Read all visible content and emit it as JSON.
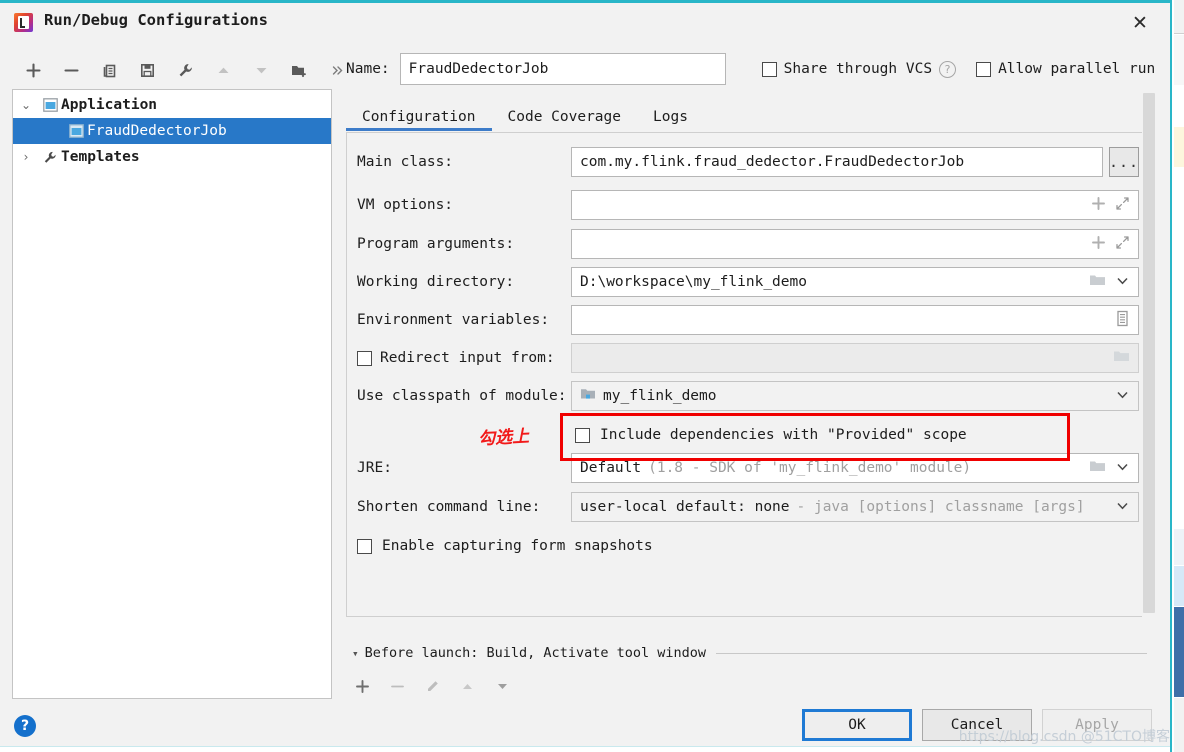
{
  "window": {
    "title": "Run/Debug Configurations",
    "app_icon": "intellij-idea-icon",
    "close_icon": "close-icon"
  },
  "toolbar": {
    "items": [
      {
        "name": "add-configuration-button",
        "icon": "plus-icon"
      },
      {
        "name": "remove-configuration-button",
        "icon": "minus-icon"
      },
      {
        "name": "copy-configuration-button",
        "icon": "copy-icon"
      },
      {
        "name": "save-configuration-button",
        "icon": "save-icon"
      },
      {
        "name": "edit-templates-button",
        "icon": "wrench-icon"
      },
      {
        "name": "move-up-button",
        "icon": "arrow-up-icon"
      },
      {
        "name": "move-down-button",
        "icon": "arrow-down-icon"
      },
      {
        "name": "new-folder-button",
        "icon": "folder-add-icon"
      },
      {
        "name": "more-options-button",
        "icon": "chevron-double-right-icon"
      }
    ]
  },
  "tree": {
    "nodes": [
      {
        "label": "Application",
        "icon": "application-icon",
        "twisty": "⌄",
        "expanded": true,
        "selected": false,
        "child": false
      },
      {
        "label": "FraudDedectorJob",
        "icon": "run-config-icon",
        "twisty": "",
        "expanded": false,
        "selected": true,
        "child": true
      },
      {
        "label": "Templates",
        "icon": "wrench-icon",
        "twisty": "›",
        "expanded": false,
        "selected": false,
        "child": false
      }
    ]
  },
  "header": {
    "name_label": "Name:",
    "name_value": "FraudDedectorJob",
    "share_vcs_label": "Share through VCS",
    "share_vcs_checked": false,
    "help_icon": "question-mark-icon",
    "allow_parallel_label": "Allow parallel run",
    "allow_parallel_checked": false
  },
  "tabs": [
    {
      "label": "Configuration",
      "active": true
    },
    {
      "label": "Code Coverage",
      "active": false
    },
    {
      "label": "Logs",
      "active": false
    }
  ],
  "form": {
    "main_class": {
      "label": "Main class:",
      "value": "com.my.flink.fraud_dedector.FraudDedectorJob",
      "browse_label": "..."
    },
    "vm_options": {
      "label": "VM options:",
      "value": "",
      "icons": [
        "plus-icon",
        "expand-icon"
      ]
    },
    "program_arguments": {
      "label": "Program arguments:",
      "value": "",
      "icons": [
        "plus-icon",
        "expand-icon"
      ]
    },
    "working_directory": {
      "label": "Working directory:",
      "value": "D:\\workspace\\my_flink_demo",
      "icons": [
        "folder-icon",
        "chevron-down-icon"
      ]
    },
    "environment_variables": {
      "label": "Environment variables:",
      "value": "",
      "icons": [
        "list-icon"
      ]
    },
    "redirect_input": {
      "label": "Redirect input from:",
      "checked": false,
      "value": "",
      "icons": [
        "folder-icon"
      ]
    },
    "use_classpath_of_module": {
      "label": "Use classpath of module:",
      "value": "my_flink_demo",
      "icons": [
        "chevron-down-icon"
      ],
      "module_icon": "module-icon"
    },
    "include_provided": {
      "label": "Include dependencies with \"Provided\" scope",
      "checked": false
    },
    "jre": {
      "label": "JRE:",
      "value": "Default",
      "value_hint": "(1.8 - SDK of 'my_flink_demo' module)",
      "icons": [
        "folder-icon",
        "chevron-down-icon"
      ]
    },
    "shorten_command_line": {
      "label": "Shorten command line:",
      "value": "user-local default: none",
      "value_hint": "- java [options] classname [args]",
      "icons": [
        "chevron-down-icon"
      ]
    },
    "enable_form_snapshots": {
      "label": "Enable capturing form snapshots",
      "checked": false
    }
  },
  "annotation": {
    "text": "勾选上",
    "color": "#f21a1a"
  },
  "before_launch": {
    "twisty": "▾",
    "label": "Before launch: Build, Activate tool window",
    "tools": [
      {
        "name": "before-launch-add-button",
        "icon": "plus-icon"
      },
      {
        "name": "before-launch-remove-button",
        "icon": "minus-icon"
      },
      {
        "name": "before-launch-edit-button",
        "icon": "pencil-icon"
      },
      {
        "name": "before-launch-move-up-button",
        "icon": "arrow-up-icon"
      },
      {
        "name": "before-launch-move-down-button",
        "icon": "arrow-down-icon"
      }
    ]
  },
  "footer": {
    "help_label": "?",
    "ok_label": "OK",
    "cancel_label": "Cancel",
    "apply_label": "Apply",
    "apply_enabled": false,
    "watermark": "https://blog.csdn   @51CTO博客"
  },
  "colors": {
    "accent": "#2878c8",
    "tab_underline": "#3d7cc9",
    "annotation_red": "#f00000",
    "window_top_border": "#29b6c8"
  }
}
